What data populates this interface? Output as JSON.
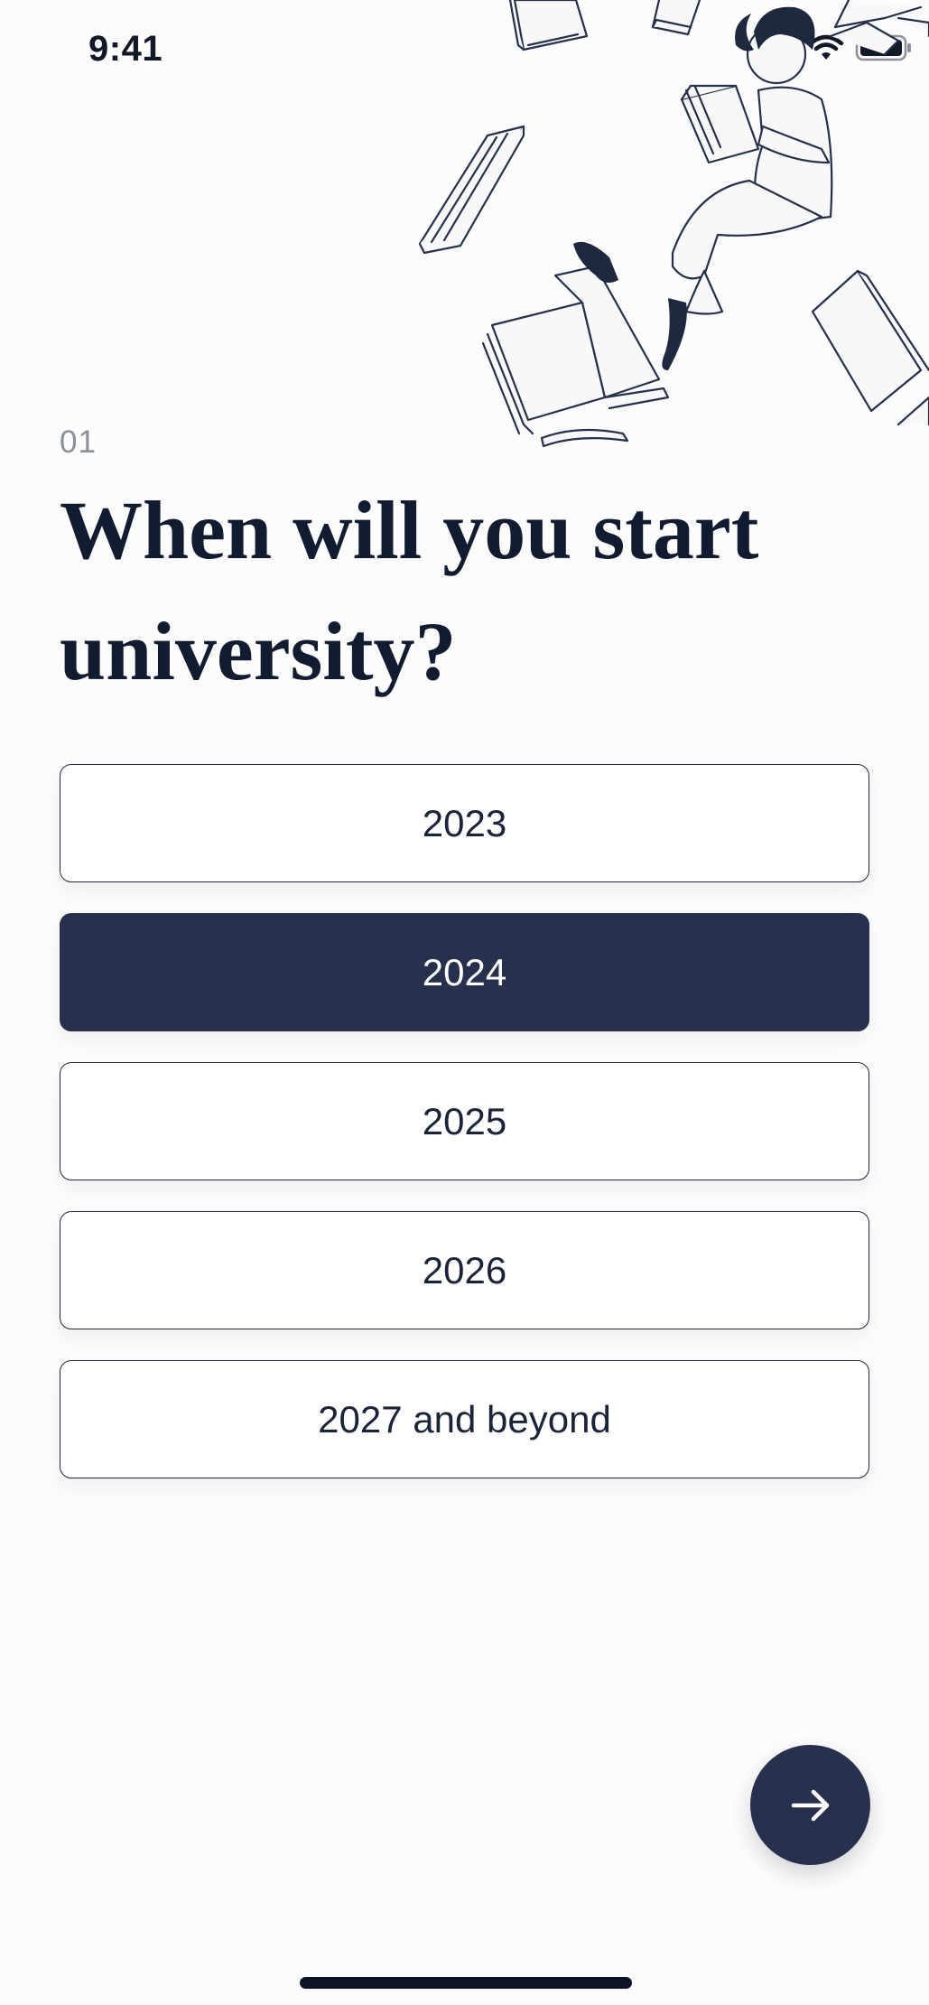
{
  "status_bar": {
    "time": "9:41"
  },
  "question": {
    "step": "01",
    "title": "When will you start university?"
  },
  "options": [
    {
      "label": "2023",
      "selected": false
    },
    {
      "label": "2024",
      "selected": true
    },
    {
      "label": "2025",
      "selected": false
    },
    {
      "label": "2026",
      "selected": false
    },
    {
      "label": "2027 and beyond",
      "selected": false
    }
  ],
  "icons": {
    "next": "arrow-right-icon",
    "illustration": "girl-reading-with-flying-books"
  },
  "colors": {
    "accent": "#27314d",
    "background": "#fcfcfc",
    "title": "#111c30",
    "step_number": "#8a8f98"
  }
}
